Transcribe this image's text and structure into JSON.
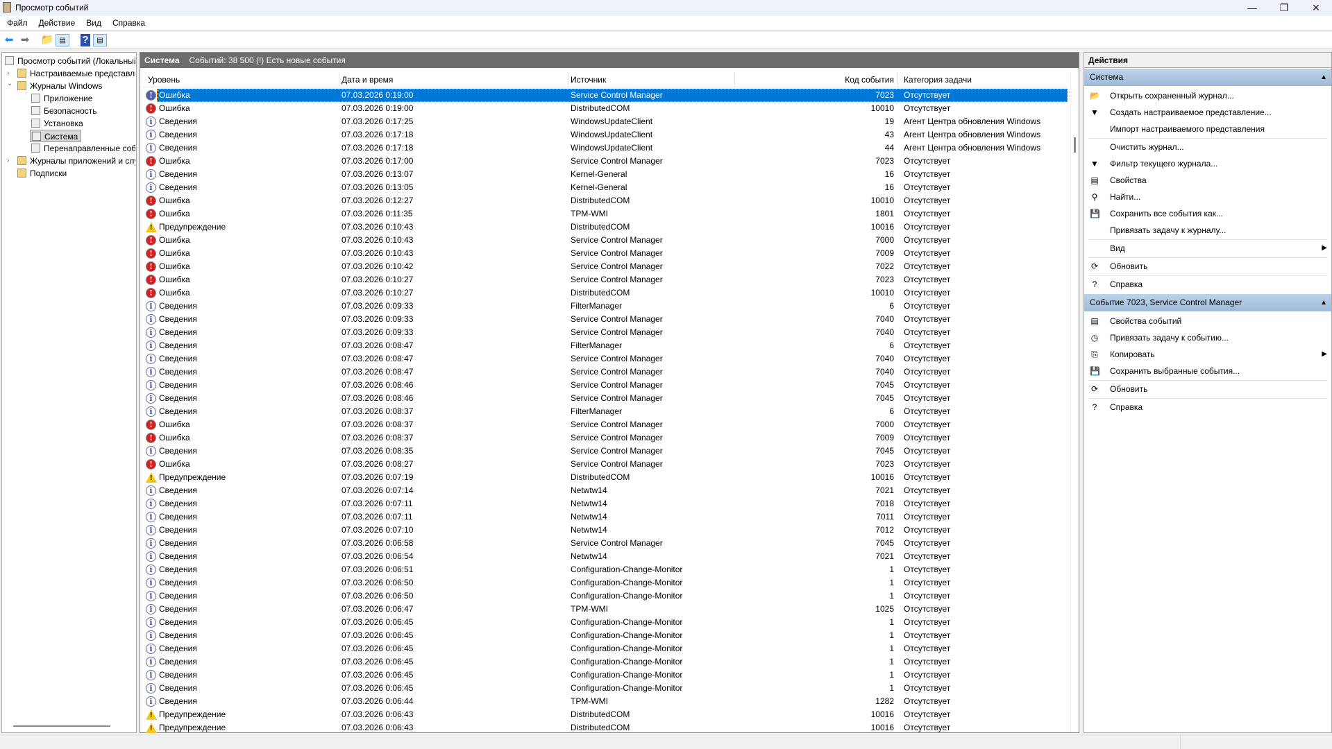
{
  "window": {
    "title": "Просмотр событий",
    "minimize": "—",
    "restore": "❐",
    "close": "✕"
  },
  "menu": [
    "Файл",
    "Действие",
    "Вид",
    "Справка"
  ],
  "tree": {
    "root": "Просмотр событий (Локальный)",
    "custom_views": "Настраиваемые представления",
    "windows_logs": "Журналы Windows",
    "application": "Приложение",
    "security": "Безопасность",
    "setup": "Установка",
    "system": "Система",
    "forwarded": "Перенаправленные события",
    "app_services_logs": "Журналы приложений и служб",
    "subscriptions": "Подписки"
  },
  "center": {
    "log_name": "Система",
    "summary": "Событий: 38 500 (!) Есть новые события"
  },
  "columns": [
    "Уровень",
    "Дата и время",
    "Источник",
    "Код события",
    "Категория задачи"
  ],
  "rows": [
    [
      "e",
      "Ошибка",
      "07.03.2026 0:19:00",
      "Service Control Manager",
      "7023",
      "Отсутствует"
    ],
    [
      "e",
      "Ошибка",
      "07.03.2026 0:19:00",
      "DistributedCOM",
      "10010",
      "Отсутствует"
    ],
    [
      "i",
      "Сведения",
      "07.03.2026 0:17:25",
      "WindowsUpdateClient",
      "19",
      "Агент Центра обновления Windows"
    ],
    [
      "i",
      "Сведения",
      "07.03.2026 0:17:18",
      "WindowsUpdateClient",
      "43",
      "Агент Центра обновления Windows"
    ],
    [
      "i",
      "Сведения",
      "07.03.2026 0:17:18",
      "WindowsUpdateClient",
      "44",
      "Агент Центра обновления Windows"
    ],
    [
      "e",
      "Ошибка",
      "07.03.2026 0:17:00",
      "Service Control Manager",
      "7023",
      "Отсутствует"
    ],
    [
      "i",
      "Сведения",
      "07.03.2026 0:13:07",
      "Kernel-General",
      "16",
      "Отсутствует"
    ],
    [
      "i",
      "Сведения",
      "07.03.2026 0:13:05",
      "Kernel-General",
      "16",
      "Отсутствует"
    ],
    [
      "e",
      "Ошибка",
      "07.03.2026 0:12:27",
      "DistributedCOM",
      "10010",
      "Отсутствует"
    ],
    [
      "e",
      "Ошибка",
      "07.03.2026 0:11:35",
      "TPM-WMI",
      "1801",
      "Отсутствует"
    ],
    [
      "w",
      "Предупреждение",
      "07.03.2026 0:10:43",
      "DistributedCOM",
      "10016",
      "Отсутствует"
    ],
    [
      "e",
      "Ошибка",
      "07.03.2026 0:10:43",
      "Service Control Manager",
      "7000",
      "Отсутствует"
    ],
    [
      "e",
      "Ошибка",
      "07.03.2026 0:10:43",
      "Service Control Manager",
      "7009",
      "Отсутствует"
    ],
    [
      "e",
      "Ошибка",
      "07.03.2026 0:10:42",
      "Service Control Manager",
      "7022",
      "Отсутствует"
    ],
    [
      "e",
      "Ошибка",
      "07.03.2026 0:10:27",
      "Service Control Manager",
      "7023",
      "Отсутствует"
    ],
    [
      "e",
      "Ошибка",
      "07.03.2026 0:10:27",
      "DistributedCOM",
      "10010",
      "Отсутствует"
    ],
    [
      "i",
      "Сведения",
      "07.03.2026 0:09:33",
      "FilterManager",
      "6",
      "Отсутствует"
    ],
    [
      "i",
      "Сведения",
      "07.03.2026 0:09:33",
      "Service Control Manager",
      "7040",
      "Отсутствует"
    ],
    [
      "i",
      "Сведения",
      "07.03.2026 0:09:33",
      "Service Control Manager",
      "7040",
      "Отсутствует"
    ],
    [
      "i",
      "Сведения",
      "07.03.2026 0:08:47",
      "FilterManager",
      "6",
      "Отсутствует"
    ],
    [
      "i",
      "Сведения",
      "07.03.2026 0:08:47",
      "Service Control Manager",
      "7040",
      "Отсутствует"
    ],
    [
      "i",
      "Сведения",
      "07.03.2026 0:08:47",
      "Service Control Manager",
      "7040",
      "Отсутствует"
    ],
    [
      "i",
      "Сведения",
      "07.03.2026 0:08:46",
      "Service Control Manager",
      "7045",
      "Отсутствует"
    ],
    [
      "i",
      "Сведения",
      "07.03.2026 0:08:46",
      "Service Control Manager",
      "7045",
      "Отсутствует"
    ],
    [
      "i",
      "Сведения",
      "07.03.2026 0:08:37",
      "FilterManager",
      "6",
      "Отсутствует"
    ],
    [
      "e",
      "Ошибка",
      "07.03.2026 0:08:37",
      "Service Control Manager",
      "7000",
      "Отсутствует"
    ],
    [
      "e",
      "Ошибка",
      "07.03.2026 0:08:37",
      "Service Control Manager",
      "7009",
      "Отсутствует"
    ],
    [
      "i",
      "Сведения",
      "07.03.2026 0:08:35",
      "Service Control Manager",
      "7045",
      "Отсутствует"
    ],
    [
      "e",
      "Ошибка",
      "07.03.2026 0:08:27",
      "Service Control Manager",
      "7023",
      "Отсутствует"
    ],
    [
      "w",
      "Предупреждение",
      "07.03.2026 0:07:19",
      "DistributedCOM",
      "10016",
      "Отсутствует"
    ],
    [
      "i",
      "Сведения",
      "07.03.2026 0:07:14",
      "Netwtw14",
      "7021",
      "Отсутствует"
    ],
    [
      "i",
      "Сведения",
      "07.03.2026 0:07:11",
      "Netwtw14",
      "7018",
      "Отсутствует"
    ],
    [
      "i",
      "Сведения",
      "07.03.2026 0:07:11",
      "Netwtw14",
      "7011",
      "Отсутствует"
    ],
    [
      "i",
      "Сведения",
      "07.03.2026 0:07:10",
      "Netwtw14",
      "7012",
      "Отсутствует"
    ],
    [
      "i",
      "Сведения",
      "07.03.2026 0:06:58",
      "Service Control Manager",
      "7045",
      "Отсутствует"
    ],
    [
      "i",
      "Сведения",
      "07.03.2026 0:06:54",
      "Netwtw14",
      "7021",
      "Отсутствует"
    ],
    [
      "i",
      "Сведения",
      "07.03.2026 0:06:51",
      "Configuration-Change-Monitor",
      "1",
      "Отсутствует"
    ],
    [
      "i",
      "Сведения",
      "07.03.2026 0:06:50",
      "Configuration-Change-Monitor",
      "1",
      "Отсутствует"
    ],
    [
      "i",
      "Сведения",
      "07.03.2026 0:06:50",
      "Configuration-Change-Monitor",
      "1",
      "Отсутствует"
    ],
    [
      "i",
      "Сведения",
      "07.03.2026 0:06:47",
      "TPM-WMI",
      "1025",
      "Отсутствует"
    ],
    [
      "i",
      "Сведения",
      "07.03.2026 0:06:45",
      "Configuration-Change-Monitor",
      "1",
      "Отсутствует"
    ],
    [
      "i",
      "Сведения",
      "07.03.2026 0:06:45",
      "Configuration-Change-Monitor",
      "1",
      "Отсутствует"
    ],
    [
      "i",
      "Сведения",
      "07.03.2026 0:06:45",
      "Configuration-Change-Monitor",
      "1",
      "Отсутствует"
    ],
    [
      "i",
      "Сведения",
      "07.03.2026 0:06:45",
      "Configuration-Change-Monitor",
      "1",
      "Отсутствует"
    ],
    [
      "i",
      "Сведения",
      "07.03.2026 0:06:45",
      "Configuration-Change-Monitor",
      "1",
      "Отсутствует"
    ],
    [
      "i",
      "Сведения",
      "07.03.2026 0:06:45",
      "Configuration-Change-Monitor",
      "1",
      "Отсутствует"
    ],
    [
      "i",
      "Сведения",
      "07.03.2026 0:06:44",
      "TPM-WMI",
      "1282",
      "Отсутствует"
    ],
    [
      "w",
      "Предупреждение",
      "07.03.2026 0:06:43",
      "DistributedCOM",
      "10016",
      "Отсутствует"
    ],
    [
      "w",
      "Предупреждение",
      "07.03.2026 0:06:43",
      "DistributedCOM",
      "10016",
      "Отсутствует"
    ]
  ],
  "actions": {
    "title": "Действия",
    "section1": "Система",
    "items1": [
      {
        "label": "Открыть сохраненный журнал...",
        "icon": "📂"
      },
      {
        "label": "Создать настраиваемое представление...",
        "icon": "▼"
      },
      {
        "label": "Импорт настраиваемого представления",
        "icon": ""
      },
      {
        "sep": true
      },
      {
        "label": "Очистить журнал...",
        "icon": ""
      },
      {
        "label": "Фильтр текущего журнала...",
        "icon": "▼"
      },
      {
        "label": "Свойства",
        "icon": "▤"
      },
      {
        "label": "Найти...",
        "icon": "⚲"
      },
      {
        "label": "Сохранить все события как...",
        "icon": "💾"
      },
      {
        "label": "Привязать задачу к журналу...",
        "icon": ""
      },
      {
        "sep": true
      },
      {
        "label": "Вид",
        "icon": "",
        "sub": true
      },
      {
        "sep": true
      },
      {
        "label": "Обновить",
        "icon": "⟳"
      },
      {
        "sep": true
      },
      {
        "label": "Справка",
        "icon": "?"
      }
    ],
    "section2": "Событие 7023, Service Control Manager",
    "items2": [
      {
        "label": "Свойства событий",
        "icon": "▤"
      },
      {
        "label": "Привязать задачу к событию...",
        "icon": "◷"
      },
      {
        "label": "Копировать",
        "icon": "⎘",
        "sub": true
      },
      {
        "label": "Сохранить выбранные события...",
        "icon": "💾"
      },
      {
        "sep": true
      },
      {
        "label": "Обновить",
        "icon": "⟳"
      },
      {
        "sep": true
      },
      {
        "label": "Справка",
        "icon": "?"
      }
    ]
  },
  "colors": {
    "selection": "#0078d7",
    "header_bar": "#6d6d6d",
    "section": "#b0c8e4"
  }
}
